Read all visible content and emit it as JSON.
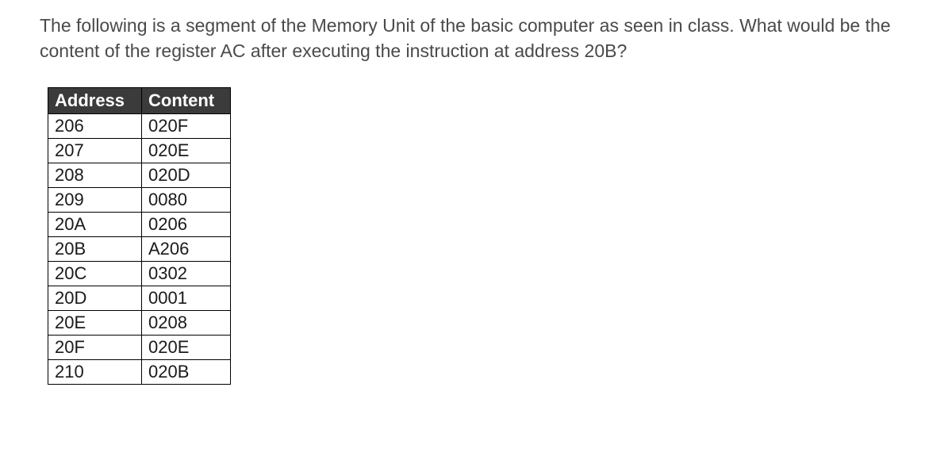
{
  "question": "The following is a segment of the Memory Unit of the basic computer as seen in class. What would be the content of the register AC after executing the instruction at address 20B?",
  "table": {
    "headers": {
      "address": "Address",
      "content": "Content"
    },
    "rows": [
      {
        "address": "206",
        "content": "020F"
      },
      {
        "address": "207",
        "content": "020E"
      },
      {
        "address": "208",
        "content": "020D"
      },
      {
        "address": "209",
        "content": "0080"
      },
      {
        "address": "20A",
        "content": "0206"
      },
      {
        "address": "20B",
        "content": "A206"
      },
      {
        "address": "20C",
        "content": "0302"
      },
      {
        "address": "20D",
        "content": "0001"
      },
      {
        "address": "20E",
        "content": "0208"
      },
      {
        "address": "20F",
        "content": "020E"
      },
      {
        "address": "210",
        "content": "020B"
      }
    ]
  }
}
